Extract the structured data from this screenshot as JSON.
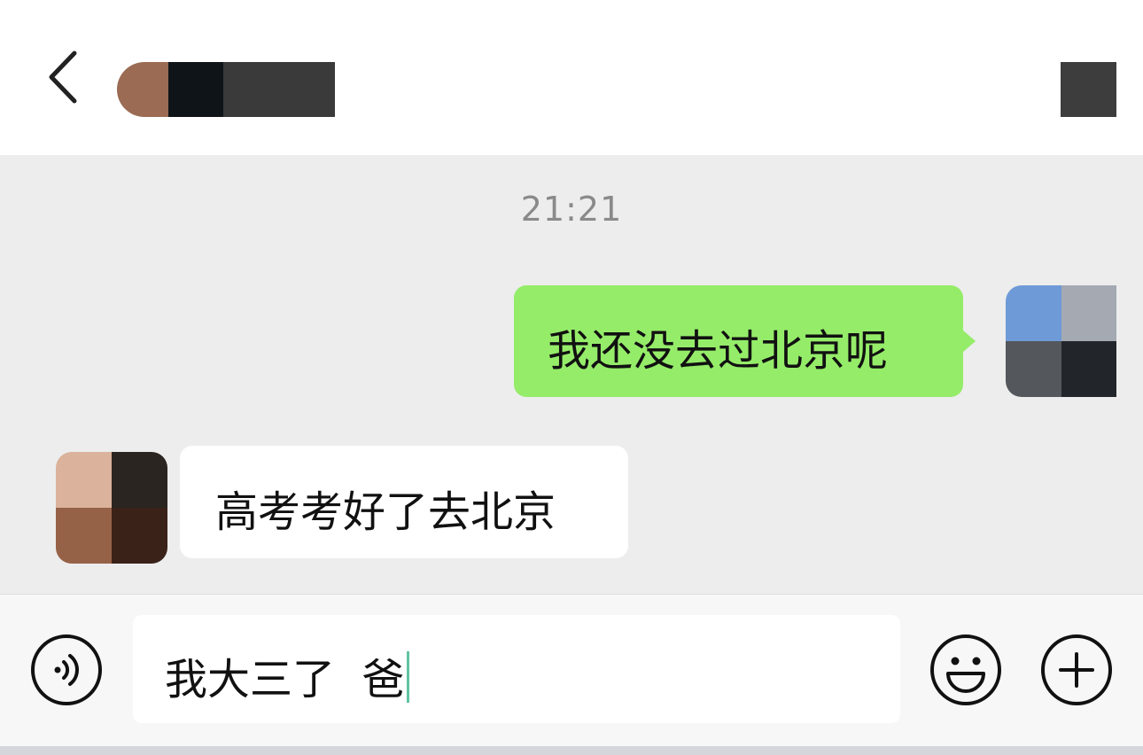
{
  "header": {
    "back_icon": "chevron-left-icon",
    "more_icon": "more-icon"
  },
  "chat": {
    "timestamp": "21:21",
    "messages": [
      {
        "side": "out",
        "text": "我还没去过北京呢"
      },
      {
        "side": "in",
        "text": "高考考好了去北京"
      }
    ]
  },
  "input_bar": {
    "value": "我大三了  爸",
    "voice_icon": "voice-icon",
    "emoji_icon": "emoji-icon",
    "add_icon": "plus-icon"
  },
  "colors": {
    "outgoing_bubble": "#95ec69",
    "incoming_bubble": "#ffffff",
    "chat_background": "#ededed"
  }
}
